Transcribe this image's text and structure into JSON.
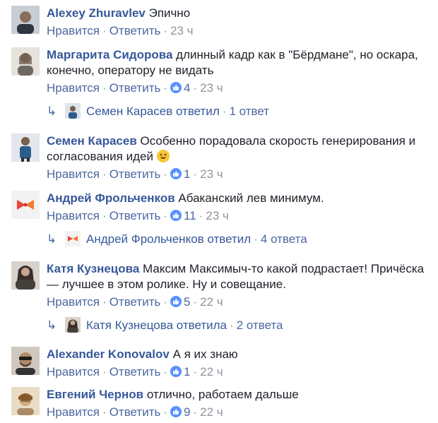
{
  "actions": {
    "like": "Нравится",
    "reply": "Ответить",
    "sep": "·"
  },
  "comments": [
    {
      "author": "Alexey Zhuravlev",
      "text": "Эпично",
      "likes": "",
      "time": "23 ч"
    },
    {
      "author": "Маргарита Сидорова",
      "text": "длинный кадр как в \"Бёрдмане\", но оскара, конечно, оператору не видать",
      "likes": "4",
      "time": "23 ч",
      "reply": {
        "summary": "Семен Карасев ответил",
        "count": "1 ответ"
      }
    },
    {
      "author": "Семен Карасев",
      "text": "Особенно порадовала скорость генерирования и согласования идей",
      "emoji": "smile-emoji",
      "likes": "1",
      "time": "23 ч"
    },
    {
      "author": "Андрей Фрольченков",
      "text": "Абаканский лев минимум.",
      "likes": "11",
      "time": "23 ч",
      "reply": {
        "summary": "Андрей Фрольченков ответил",
        "count": "4 ответа"
      }
    },
    {
      "author": "Катя Кузнецова",
      "text": "Максим Максимыч-то какой подрастает! Причёска — лучшее в этом ролике. Ну и совещание.",
      "likes": "5",
      "time": "22 ч",
      "reply": {
        "summary": "Катя Кузнецова ответила",
        "count": "2 ответа"
      }
    },
    {
      "author": "Alexander Konovalov",
      "text": "А я их знаю",
      "likes": "1",
      "time": "22 ч"
    },
    {
      "author": "Евгений Чернов",
      "text": "отлично, работаем дальше",
      "likes": "9",
      "time": "22 ч"
    }
  ],
  "colors": {
    "author": "#365899",
    "link": "#4b67a0",
    "meta": "#90949c",
    "like_badge": "#5890ff"
  }
}
